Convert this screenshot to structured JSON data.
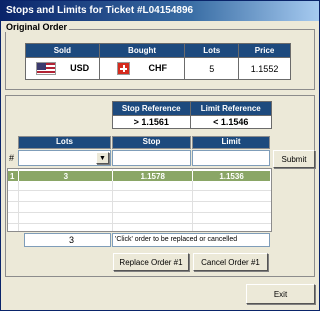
{
  "window": {
    "title": "Stops and Limits for Ticket #L04154896"
  },
  "original_order": {
    "group_label": "Original Order",
    "headers": [
      "Sold",
      "Bought",
      "Lots",
      "Price"
    ],
    "sold_currency": "USD",
    "bought_currency": "CHF",
    "lots": "5",
    "price": "1.1552"
  },
  "reference": {
    "stop_header": "Stop Reference",
    "limit_header": "Limit Reference",
    "stop_value": "> 1.1561",
    "limit_value": "< 1.1546"
  },
  "entry": {
    "num_label": "#",
    "headers": [
      "Lots",
      "Stop",
      "Limit"
    ],
    "submit_label": "Submit"
  },
  "orders_list": {
    "rows": [
      {
        "num": "1",
        "lots": "3",
        "stop": "1.1578",
        "limit": "1.1536"
      }
    ]
  },
  "selection": {
    "lots_value": "3",
    "hint": "'Click' order to be replaced or cancelled",
    "replace_label": "Replace Order #1",
    "cancel_label": "Cancel Order #1"
  },
  "footer": {
    "exit_label": "Exit"
  },
  "colors": {
    "header_blue": "#1d4a7e",
    "selected_row": "#8aa666"
  }
}
